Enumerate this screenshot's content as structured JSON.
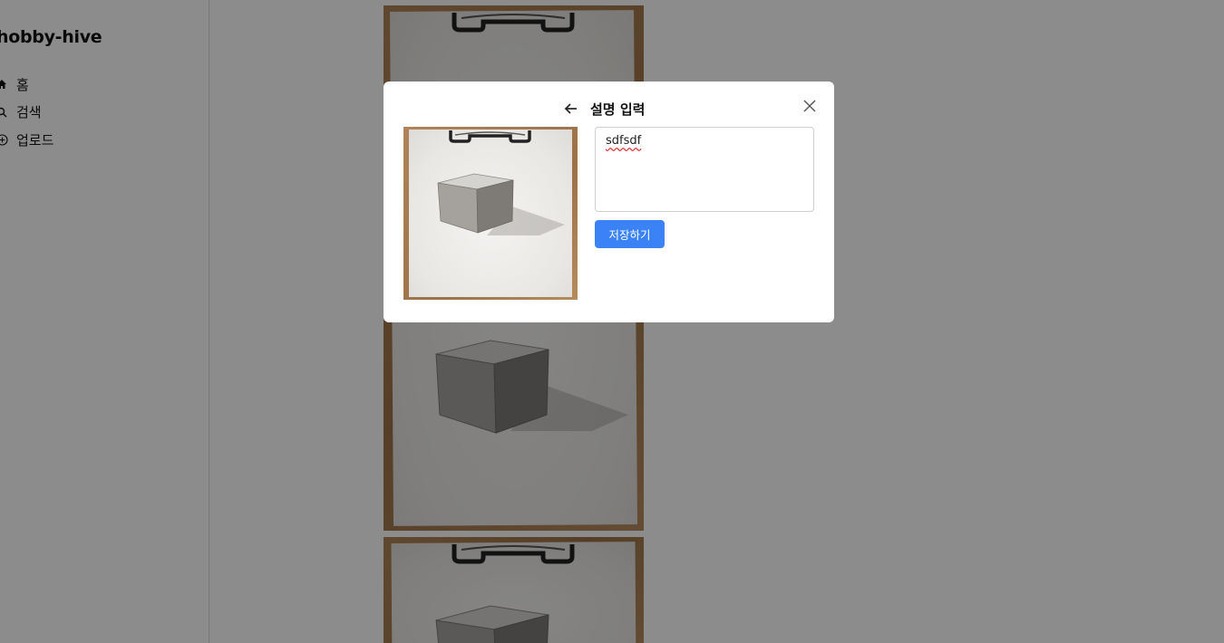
{
  "app": {
    "brand": "hobby-hive"
  },
  "sidebar": {
    "items": [
      {
        "label": "홈",
        "icon": "home-icon"
      },
      {
        "label": "검색",
        "icon": "search-icon"
      },
      {
        "label": "업로드",
        "icon": "plus-circle-icon"
      }
    ]
  },
  "feed": {
    "posts": [
      {
        "image": "pencil sketch of a cube on a clipboard"
      },
      {
        "image": "pencil sketch of a cube on a clipboard"
      }
    ]
  },
  "modal": {
    "title": "설명 입력",
    "back_icon": "arrow-left-icon",
    "close_icon": "close-icon",
    "description_value": "sdfsdf",
    "save_label": "저장하기"
  },
  "colors": {
    "accent": "#3b82f6",
    "overlay": "rgba(0,0,0,0.45)",
    "clipboard": "#a57a4f"
  }
}
